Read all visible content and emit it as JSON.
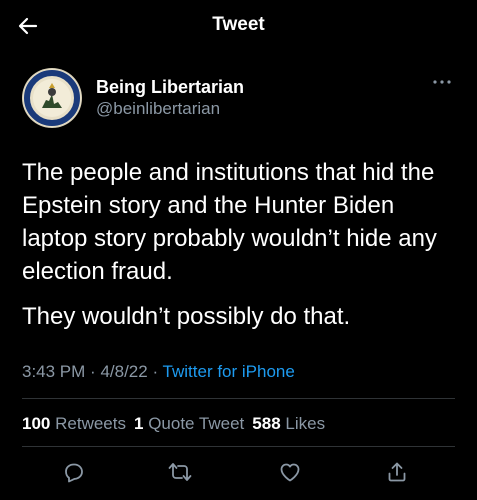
{
  "header": {
    "title": "Tweet",
    "back_icon": "arrow-left-icon"
  },
  "author": {
    "display_name": "Being Libertarian",
    "handle": "@beinlibertarian"
  },
  "tweet": {
    "paragraph_1": "The people and institutions that hid the Epstein story and the Hunter Biden laptop story probably wouldn’t hide any election fraud.",
    "paragraph_2": "They wouldn’t possibly do that.",
    "time": "3:43 PM",
    "date": "4/8/22",
    "separator": "·",
    "source": "Twitter for iPhone"
  },
  "stats": {
    "retweets_count": "100",
    "retweets_label": "Retweets",
    "quotes_count": "1",
    "quotes_label": "Quote Tweet",
    "likes_count": "588",
    "likes_label": "Likes"
  },
  "actions": [
    "reply-icon",
    "retweet-icon",
    "like-icon",
    "share-icon"
  ],
  "colors": {
    "background": "#000000",
    "text": "#ffffff",
    "secondary": "#8b98a5",
    "link": "#1d9bf0",
    "divider": "#2f3336"
  }
}
